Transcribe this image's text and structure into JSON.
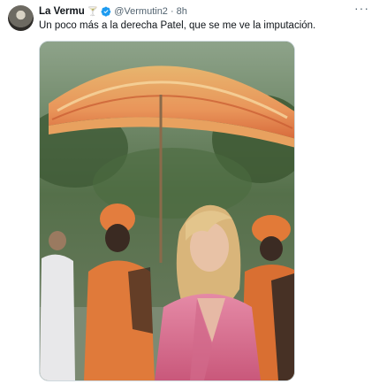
{
  "tweet": {
    "author_name": "La Vermu",
    "name_emoji": "🍸",
    "handle": "@Vermutin2",
    "separator": "·",
    "time": "8h",
    "more_label": "···",
    "text": "Un poco más a la derecha Patel, que se me ve la imputación."
  },
  "icons": {
    "avatar": "avatar",
    "verified": "verified-badge-icon",
    "more": "more-options-icon"
  },
  "colors": {
    "verified_blue": "#1d9bf0",
    "secondary_text": "#536471",
    "primary_text": "#0f1419"
  }
}
